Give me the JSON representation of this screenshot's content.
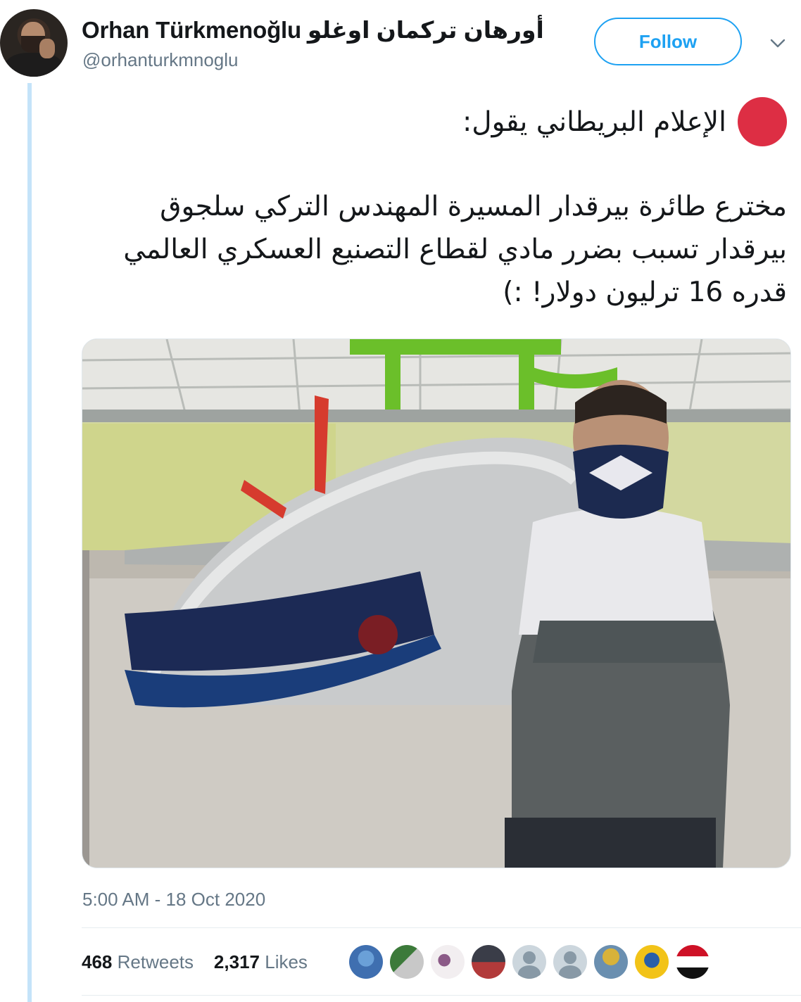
{
  "user": {
    "display_name": "Orhan Türkmenoğlu أورهان تركمان اوغلو",
    "handle": "@orhanturkmnoglu"
  },
  "follow_label": "Follow",
  "tweet": {
    "line1": "الإعلام البريطاني يقول:",
    "paragraph": "مخترع طائرة بيرقدار المسيرة المهندس التركي سلجوق بيرقدار تسبب بضرر مادي لقطاع التصنيع العسكري العالمي قدره 16 ترليون دولار! :)",
    "emoji": "red-circle"
  },
  "timestamp": "5:00 AM - 18 Oct 2020",
  "stats": {
    "retweets_count": "468",
    "retweets_label": "Retweets",
    "likes_count": "2,317",
    "likes_label": "Likes"
  },
  "colors": {
    "accent": "#1da1f2",
    "thread_line": "#c4e3f9",
    "muted": "#657786",
    "red_circle": "#dd2e44"
  },
  "icons": [
    "chevron-down-icon",
    "red-circle-emoji"
  ]
}
